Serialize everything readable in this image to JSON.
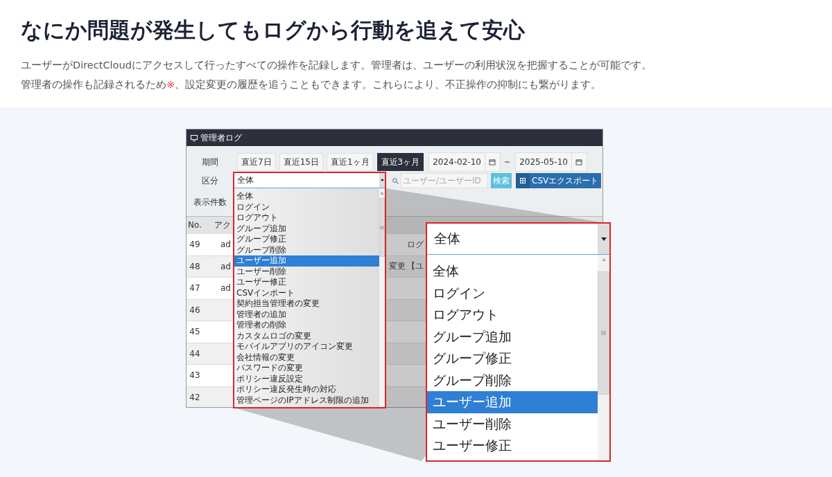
{
  "heading": "なにか問題が発生してもログから行動を追えて安心",
  "intro": [
    {
      "parts": [
        {
          "kind": "plain",
          "text": "ユーザーがDirectCloudにアクセスして行ったすべての操作を記録します。管理者は、ユーザーの利用状況を把握することが可能です。"
        }
      ]
    },
    {
      "parts": [
        {
          "kind": "plain",
          "text": "管理者の操作も記録されるため"
        },
        {
          "kind": "note",
          "text": "※"
        },
        {
          "kind": "plain",
          "text": "、設定変更の履歴を追うこともできます。これらにより、不正操作の抑制にも繋がります。"
        }
      ]
    }
  ],
  "admin_log": {
    "title": "管理者ログ",
    "period_label": "期間",
    "period_buttons": [
      {
        "label": "直近7日",
        "selected": false
      },
      {
        "label": "直近15日",
        "selected": false
      },
      {
        "label": "直近1ヶ月",
        "selected": false
      },
      {
        "label": "直近3ヶ月",
        "selected": true
      }
    ],
    "date_from": "2024-02-10",
    "date_separator": "~",
    "date_to": "2025-05-10",
    "category_label": "区分",
    "category_select": {
      "value": "全体",
      "options": [
        {
          "label": "全体",
          "highlighted": false
        },
        {
          "label": "ログイン",
          "highlighted": false
        },
        {
          "label": "ログアウト",
          "highlighted": false
        },
        {
          "label": "グループ追加",
          "highlighted": false
        },
        {
          "label": "グループ修正",
          "highlighted": false
        },
        {
          "label": "グループ削除",
          "highlighted": false
        },
        {
          "label": "ユーザー追加",
          "highlighted": true
        },
        {
          "label": "ユーザー削除",
          "highlighted": false
        },
        {
          "label": "ユーザー修正",
          "highlighted": false
        },
        {
          "label": "CSVインポート",
          "highlighted": false
        },
        {
          "label": "契約担当管理者の変更",
          "highlighted": false
        },
        {
          "label": "管理者の追加",
          "highlighted": false
        },
        {
          "label": "管理者の削除",
          "highlighted": false
        },
        {
          "label": "カスタムロゴの変更",
          "highlighted": false
        },
        {
          "label": "モバイルアプリのアイコン変更",
          "highlighted": false
        },
        {
          "label": "会社情報の変更",
          "highlighted": false
        },
        {
          "label": "パスワードの変更",
          "highlighted": false
        },
        {
          "label": "ポリシー違反設定",
          "highlighted": false
        },
        {
          "label": "ポリシー違反発生時の対応",
          "highlighted": false
        },
        {
          "label": "管理ページのIPアドレス制限の追加",
          "highlighted": false
        }
      ]
    },
    "search": {
      "placeholder": "ユーザー/ユーザーID"
    },
    "search_button": "検索",
    "csv_button": "CSVエクスポート",
    "per_page_label": "表示件数",
    "table": {
      "columns": [
        "No.",
        "アク"
      ],
      "rows": [
        {
          "no": "49",
          "column_2": "ad",
          "column_4": "ログ"
        },
        {
          "no": "48",
          "column_2": "ad",
          "column_3": "変更",
          "column_4": "【ユ"
        },
        {
          "no": "47",
          "column_2": "ad"
        },
        {
          "no": "46"
        },
        {
          "no": "45"
        },
        {
          "no": "44"
        },
        {
          "no": "43"
        },
        {
          "no": "42"
        }
      ]
    }
  },
  "zoom_callout": {
    "value": "全体",
    "options": [
      {
        "label": "全体",
        "highlighted": false
      },
      {
        "label": "ログイン",
        "highlighted": false
      },
      {
        "label": "ログアウト",
        "highlighted": false
      },
      {
        "label": "グループ追加",
        "highlighted": false
      },
      {
        "label": "グループ修正",
        "highlighted": false
      },
      {
        "label": "グループ削除",
        "highlighted": false
      },
      {
        "label": "ユーザー追加",
        "highlighted": true
      },
      {
        "label": "ユーザー削除",
        "highlighted": false
      },
      {
        "label": "ユーザー修正",
        "highlighted": false
      }
    ]
  }
}
